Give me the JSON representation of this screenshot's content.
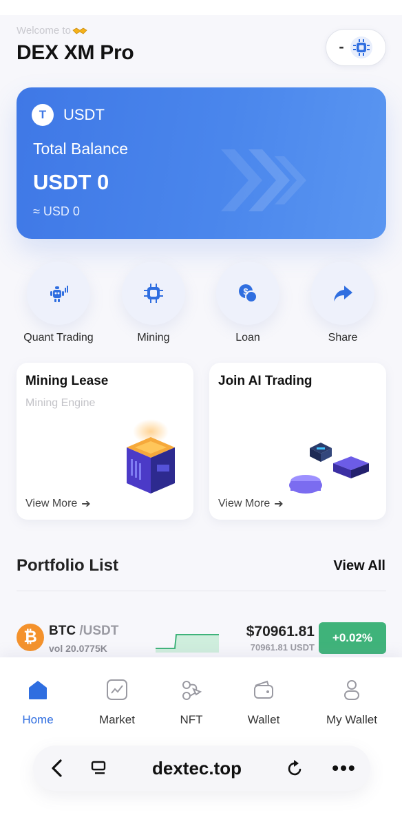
{
  "header": {
    "welcome_text": "Welcome to",
    "app_title": "DEX XM Pro",
    "toggle_label": "-"
  },
  "balance": {
    "coin_letter": "T",
    "coin_name": "USDT",
    "label": "Total Balance",
    "value": "USDT 0",
    "usd_equiv": "≈ USD 0"
  },
  "actions": [
    {
      "label": "Quant Trading",
      "icon": "robot-icon"
    },
    {
      "label": "Mining",
      "icon": "chip-icon"
    },
    {
      "label": "Loan",
      "icon": "coin-loan-icon"
    },
    {
      "label": "Share",
      "icon": "share-arrow-icon"
    }
  ],
  "promos": [
    {
      "title": "Mining Lease",
      "subtitle": "Mining Engine",
      "more": "View More"
    },
    {
      "title": "Join AI Trading",
      "subtitle": "",
      "more": "View More"
    }
  ],
  "portfolio": {
    "title": "Portfolio List",
    "view_all": "View All",
    "rows": [
      {
        "base": "BTC",
        "quote": "/USDT",
        "volume": "vol 20.0775K",
        "price": "$70961.81",
        "price_sub": "70961.81 USDT",
        "change": "+0.02%"
      }
    ]
  },
  "tabs": [
    {
      "label": "Home",
      "icon": "home-icon",
      "active": true
    },
    {
      "label": "Market",
      "icon": "chart-icon",
      "active": false
    },
    {
      "label": "NFT",
      "icon": "nft-icon",
      "active": false
    },
    {
      "label": "Wallet",
      "icon": "wallet-icon",
      "active": false
    },
    {
      "label": "My Wallet",
      "icon": "user-icon",
      "active": false
    }
  ],
  "browser": {
    "url": "dextec.top",
    "more": "•••"
  },
  "colors": {
    "accent": "#2f6ee0",
    "card_blue": "#4a86ec",
    "positive": "#3fb37a",
    "btc_orange": "#f4922c"
  }
}
